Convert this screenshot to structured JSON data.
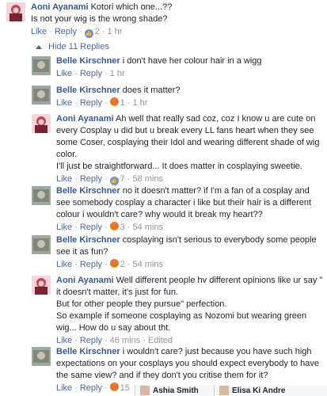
{
  "comments": [
    {
      "author": "Aoni Ayanami",
      "text": "Kotori which one...??\nIs not your wig is the wrong shade?",
      "like": "Like",
      "reply": "Reply",
      "reaction": "like",
      "count": "2",
      "time": "1 hr"
    },
    {
      "author": "Belle Kirschner",
      "text": "i don't have her colour hair in a wigg",
      "like": "Like",
      "reply": "Reply",
      "time": "1 hr"
    },
    {
      "author": "Belle Kirschner",
      "text": "does it matter?",
      "like": "Like",
      "reply": "Reply",
      "reaction": "angry",
      "count": "1",
      "time": "1 hr"
    },
    {
      "author": "Aoni Ayanami",
      "text": "Ah well that really sad coz, coz I know u are cute on every Cosplay u did but u break every LL fans heart when they see some Coser, cosplaying their Idol and wearing different shade of wig color.\nI'll just be straightforward... It does matter in cosplaying sweetie.",
      "like": "Like",
      "reply": "Reply",
      "reaction": "like",
      "count": "7",
      "time": "58 mins"
    },
    {
      "author": "Belle Kirschner",
      "text": "no it doesn't matter? if I'm a fan of a cosplay and see somebody cosplay a character i like but their hair is a different colour i wouldn't care? why would it break my heart??",
      "like": "Like",
      "reply": "Reply",
      "reaction": "angry",
      "count": "3",
      "time": "54 mins"
    },
    {
      "author": "Belle Kirschner",
      "text": "cosplaying isn't serious to everybody some people see it as fun?",
      "like": "Like",
      "reply": "Reply",
      "reaction": "angry",
      "count": "2",
      "time": "54 mins"
    },
    {
      "author": "Aoni Ayanami",
      "text": "Well different people hv different opinions like ur say \" it doesn't matter, it's just for fun.\nBut for other people they pursue\" perfection.\nSo example if someone cosplaying as Nozomi but wearing green wig... How do u say about tht.",
      "like": "Like",
      "reply": "Reply",
      "time": "46 mins",
      "edited": "Edited"
    },
    {
      "author": "Belle Kirschner",
      "text": "i wouldn't care? just because you have such high expectations on your cosplays you should expect everybody to have the same view? and if they don't you critise them for it?",
      "like": "Like",
      "reply": "Reply",
      "reaction": "angry",
      "count": "15"
    }
  ],
  "replies_toggle": "Hide 11 Replies",
  "chat_tabs": [
    "Ashia Smith",
    "Elisa Ki Andre"
  ],
  "colors": {
    "author": "#365899",
    "link": "#4b67a1",
    "meta": "#90949c",
    "like_reaction": "#5890ff",
    "angry_reaction": "#e9710f"
  }
}
